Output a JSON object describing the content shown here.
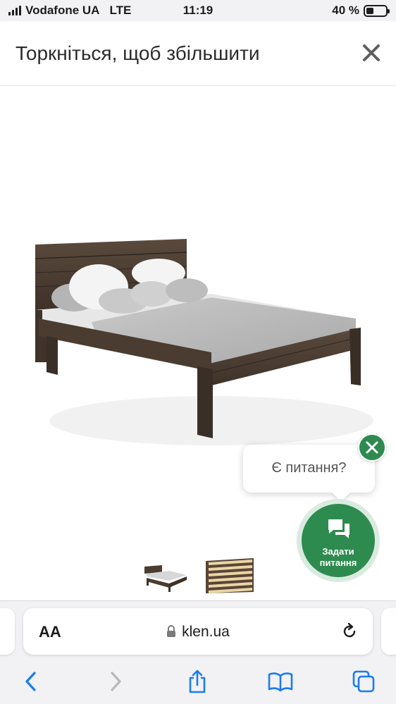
{
  "status_bar": {
    "carrier": "Vodafone UA",
    "network": "LTE",
    "time": "11:19",
    "battery_percent": "40 %",
    "battery_level": 0.4
  },
  "modal": {
    "title": "Торкніться, щоб збільшити",
    "close_icon": "close-icon"
  },
  "product_image": {
    "thumbnails": [
      {
        "name": "bed-thumbnail"
      },
      {
        "name": "slats-thumbnail"
      }
    ]
  },
  "chat": {
    "bubble_text": "Є питання?",
    "button_label_line1": "Задати",
    "button_label_line2": "питання",
    "close_icon": "close-icon",
    "colors": {
      "accent": "#2e8b4f",
      "ring": "#d9ebe0"
    }
  },
  "browser": {
    "text_size_label": "AA",
    "url": "klen.ua",
    "icons": {
      "lock": "lock-icon",
      "reload": "reload-icon",
      "back": "back-icon",
      "forward": "forward-icon",
      "share": "share-icon",
      "bookmarks": "bookmarks-icon",
      "tabs": "tabs-icon"
    },
    "accent": "#1a7cf0"
  }
}
